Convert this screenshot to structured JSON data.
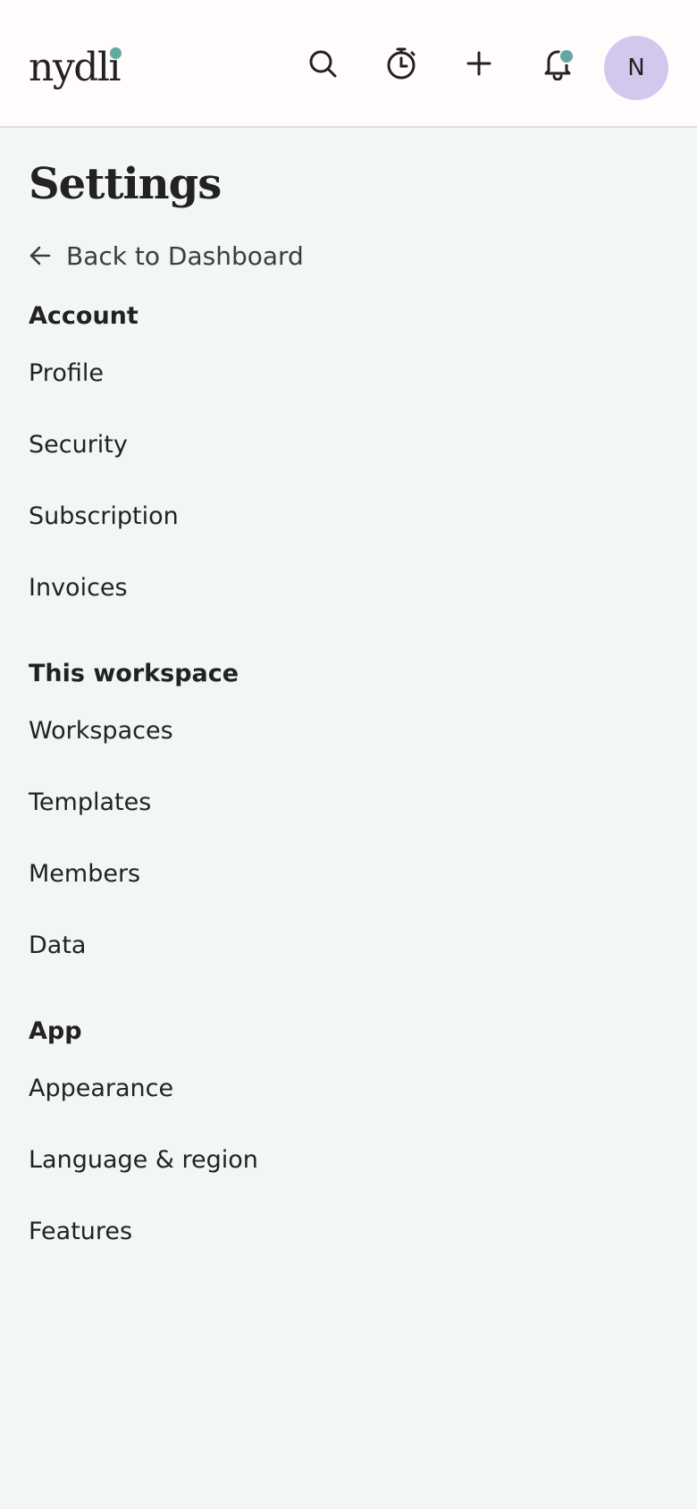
{
  "header": {
    "logo_text": "nydli",
    "avatar_initial": "N",
    "icons": {
      "search": "search-icon",
      "timer": "stopwatch-icon",
      "add": "plus-icon",
      "notifications": "bell-icon"
    },
    "colors": {
      "accent_dot": "#62a8a1",
      "avatar_bg": "#d4c7ee",
      "header_bg": "#fffcfb"
    }
  },
  "page": {
    "title": "Settings",
    "back_label": "Back to Dashboard",
    "background": "#f2f7f3"
  },
  "sections": {
    "account": {
      "title": "Account",
      "items": [
        "Profile",
        "Security",
        "Subscription",
        "Invoices"
      ]
    },
    "workspace": {
      "title": "This workspace",
      "items": [
        "Workspaces",
        "Templates",
        "Members",
        "Data"
      ]
    },
    "app": {
      "title": "App",
      "items": [
        "Appearance",
        "Language & region",
        "Features"
      ]
    }
  }
}
